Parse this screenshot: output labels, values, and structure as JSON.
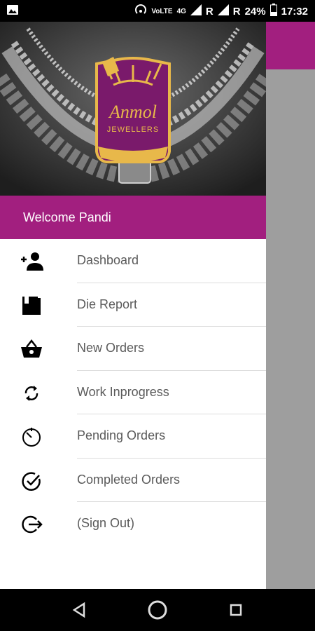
{
  "status_bar": {
    "network_labels": [
      "VoLTE",
      "4G"
    ],
    "roaming_1": "R",
    "roaming_2": "R",
    "battery": "24%",
    "time": "17:32"
  },
  "brand": {
    "name": "Anmol",
    "subtitle": "JEWELLERS"
  },
  "drawer": {
    "welcome_text": "Welcome Pandi",
    "items": [
      {
        "label": "Dashboard",
        "icon": "add-person-icon"
      },
      {
        "label": "Die Report",
        "icon": "book-icon"
      },
      {
        "label": "New Orders",
        "icon": "basket-icon"
      },
      {
        "label": "Work Inprogress",
        "icon": "sync-icon"
      },
      {
        "label": "Pending Orders",
        "icon": "timer-icon"
      },
      {
        "label": "Completed Orders",
        "icon": "check-circle-icon"
      },
      {
        "label": "(Sign Out)",
        "icon": "sign-out-icon"
      }
    ]
  },
  "colors": {
    "primary": "#a21f7f",
    "status_bar": "#000000",
    "menu_text": "#5a5a5a",
    "gold": "#e8b84a"
  }
}
